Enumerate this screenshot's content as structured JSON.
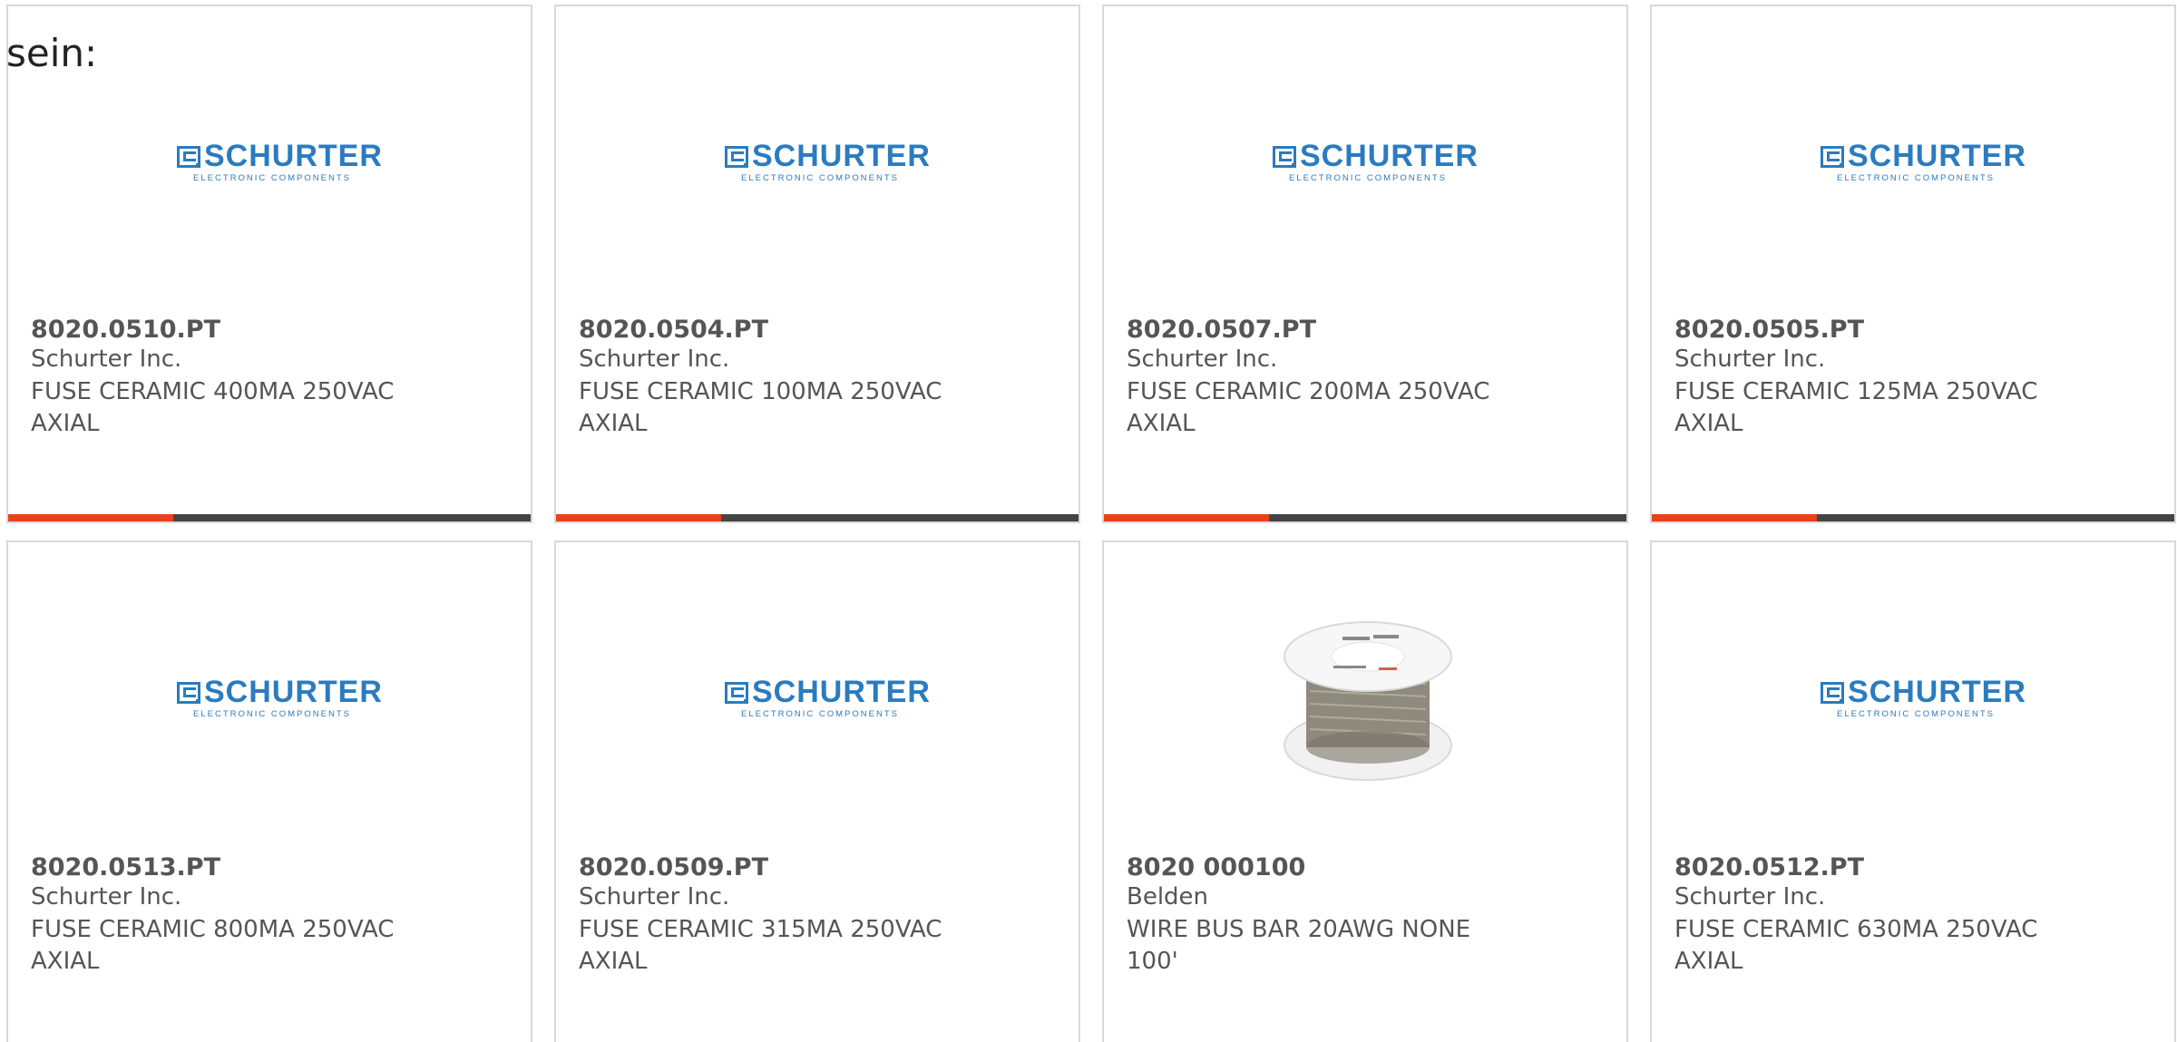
{
  "intro_text": "sein:",
  "logo": {
    "name": "SCHURTER",
    "subtitle": "ELECTRONIC COMPONENTS"
  },
  "colors": {
    "accent": "#e8421a",
    "bar_track": "#444444",
    "logo_blue": "#2b7bbf",
    "text": "#555555"
  },
  "products": [
    {
      "part_no": "8020.0510.PT",
      "maker": "Schurter Inc.",
      "desc_line1": "FUSE CERAMIC 400MA 250VAC",
      "desc_line2": "AXIAL",
      "image": "schurter-logo"
    },
    {
      "part_no": "8020.0504.PT",
      "maker": "Schurter Inc.",
      "desc_line1": "FUSE CERAMIC 100MA 250VAC",
      "desc_line2": "AXIAL",
      "image": "schurter-logo"
    },
    {
      "part_no": "8020.0507.PT",
      "maker": "Schurter Inc.",
      "desc_line1": "FUSE CERAMIC 200MA 250VAC",
      "desc_line2": "AXIAL",
      "image": "schurter-logo"
    },
    {
      "part_no": "8020.0505.PT",
      "maker": "Schurter Inc.",
      "desc_line1": "FUSE CERAMIC 125MA 250VAC",
      "desc_line2": "AXIAL",
      "image": "schurter-logo"
    },
    {
      "part_no": "8020.0513.PT",
      "maker": "Schurter Inc.",
      "desc_line1": "FUSE CERAMIC 800MA 250VAC",
      "desc_line2": "AXIAL",
      "image": "schurter-logo"
    },
    {
      "part_no": "8020.0509.PT",
      "maker": "Schurter Inc.",
      "desc_line1": "FUSE CERAMIC 315MA 250VAC",
      "desc_line2": "AXIAL",
      "image": "schurter-logo"
    },
    {
      "part_no": "8020 000100",
      "maker": "Belden",
      "desc_line1": "WIRE BUS BAR 20AWG NONE",
      "desc_line2": "100'",
      "image": "wire-spool"
    },
    {
      "part_no": "8020.0512.PT",
      "maker": "Schurter Inc.",
      "desc_line1": "FUSE CERAMIC 630MA 250VAC",
      "desc_line2": "AXIAL",
      "image": "schurter-logo"
    }
  ]
}
